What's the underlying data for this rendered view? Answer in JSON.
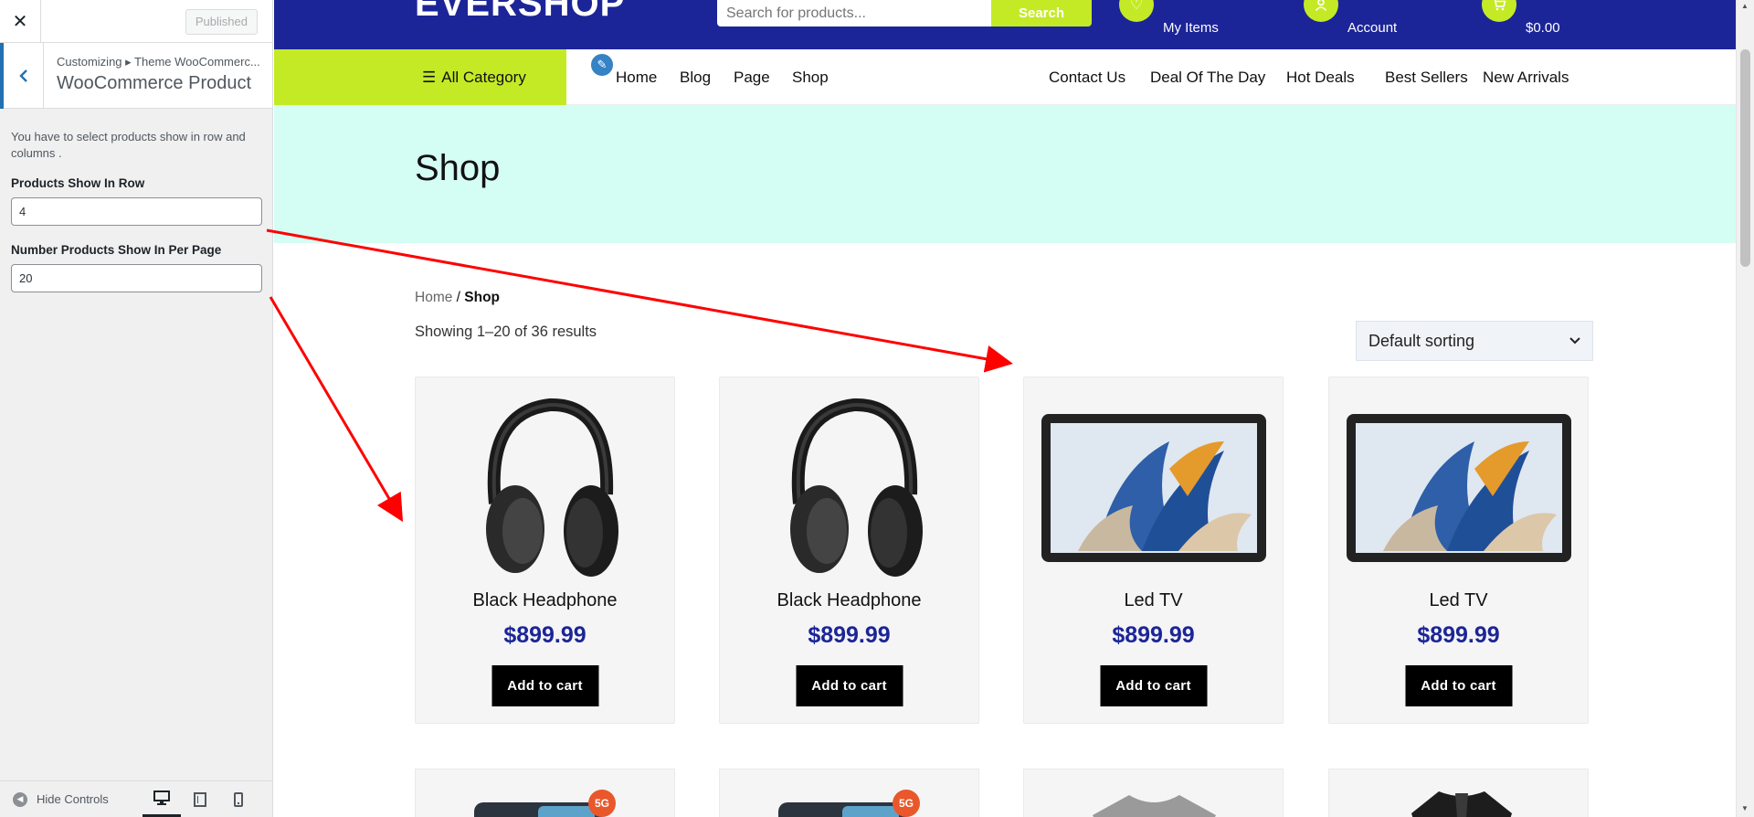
{
  "customizer": {
    "close_label": "✕",
    "published_label": "Published",
    "breadcrumb": "Customizing ▸ Theme WooCommerc...",
    "section_title": "WooCommerce Product",
    "description": "You have to select products show in row and columns .",
    "fields": [
      {
        "label": "Products Show In Row",
        "value": "4"
      },
      {
        "label": "Number Products Show In Per Page",
        "value": "20"
      }
    ],
    "hide_controls_label": "Hide Controls"
  },
  "site": {
    "logo": "EVERSHOP",
    "search_placeholder": "Search for products...",
    "search_button": "Search",
    "wishlist_label": "My Items",
    "account_label": "Account",
    "cart_total": "$0.00",
    "all_category": "All Category",
    "nav_left": [
      "Home",
      "Blog",
      "Page",
      "Shop"
    ],
    "nav_right": [
      "Contact Us",
      "Deal Of The Day",
      "Hot Deals",
      "Best Sellers",
      "New Arrivals"
    ]
  },
  "shop": {
    "title": "Shop",
    "breadcrumb_home": "Home",
    "breadcrumb_sep": " / ",
    "breadcrumb_current": "Shop",
    "result_count": "Showing 1–20 of 36 results",
    "sort_selected": "Default sorting",
    "add_to_cart": "Add to cart",
    "products": [
      {
        "name": "Black Headphone",
        "price": "$899.99",
        "image": "headphone"
      },
      {
        "name": "Black Headphone",
        "price": "$899.99",
        "image": "headphone"
      },
      {
        "name": "Led TV",
        "price": "$899.99",
        "image": "tablet"
      },
      {
        "name": "Led TV",
        "price": "$899.99",
        "image": "tablet"
      }
    ],
    "badge": "5G"
  },
  "colors": {
    "topbar": "#1c2597",
    "accent": "#c4ea26",
    "hero": "#d4fdf3",
    "annotation_arrow": "#ff0000"
  }
}
